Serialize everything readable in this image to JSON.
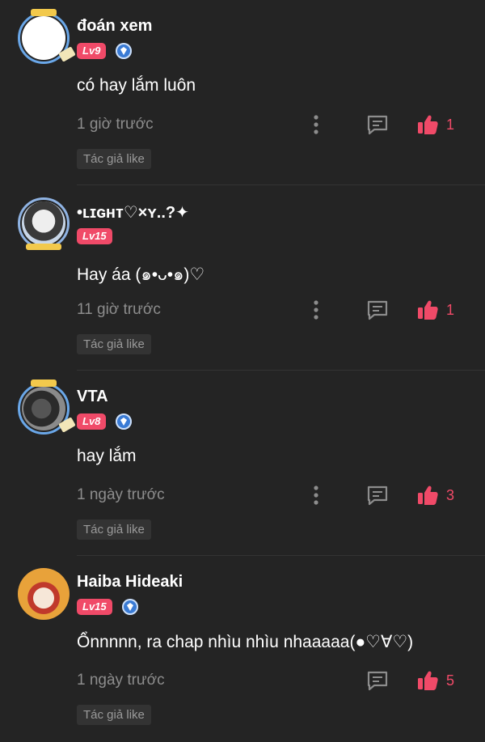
{
  "comments": [
    {
      "username": "đoán xem",
      "level": "Lv9",
      "verified": true,
      "text": "có hay lắm luôn",
      "time": "1 giờ trước",
      "likes": "1",
      "author_like": "Tác giả like",
      "avatar_badge": "WRITER"
    },
    {
      "username": "•ʟɪɢʜᴛ♡×ʏ..?✦",
      "level": "Lv15",
      "verified": false,
      "text": "Hay áa (๑•ᴗ•๑)♡",
      "time": "11 giờ trước",
      "likes": "1",
      "author_like": "Tác giả like"
    },
    {
      "username": "VTA",
      "level": "Lv8",
      "verified": true,
      "text": "hay lắm",
      "time": "1 ngày trước",
      "likes": "3",
      "author_like": "Tác giả like",
      "avatar_badge": "WRITER"
    },
    {
      "username": "Haiba Hideaki",
      "level": "Lv15",
      "verified": true,
      "text": "Ổnnnnn, ra chap nhìu nhìu nhaaaaa(●♡∀♡)",
      "time": "1 ngày trước",
      "likes": "5",
      "author_like": "Tác giả like"
    }
  ],
  "colors": {
    "background": "#242424",
    "level_badge": "#f04a68",
    "like": "#f04a68",
    "muted_text": "#8d8d8d",
    "verify": "#3a7bd5"
  },
  "icons": {
    "more": "more-vertical-icon",
    "reply": "comment-icon",
    "like": "thumbs-up-icon",
    "verified": "verified-badge-icon"
  }
}
